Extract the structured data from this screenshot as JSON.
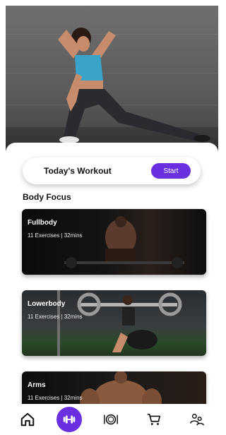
{
  "workout": {
    "title": "Today's Workout",
    "start_label": "Start"
  },
  "body_focus": {
    "title": "Body Focus",
    "cards": [
      {
        "name": "Fullbody",
        "meta": "11 Exercises | 32mins"
      },
      {
        "name": "Lowerbody",
        "meta": "11 Exercises | 32mins"
      },
      {
        "name": "Arms",
        "meta": "11 Exercises | 32mins"
      }
    ]
  },
  "nav": {
    "items": [
      {
        "icon": "home-icon"
      },
      {
        "icon": "dumbbell-icon",
        "active": true
      },
      {
        "icon": "plate-icon"
      },
      {
        "icon": "cart-icon"
      },
      {
        "icon": "users-icon"
      }
    ]
  },
  "colors": {
    "accent": "#6a2fe0",
    "card_bg": "#ffffff"
  }
}
